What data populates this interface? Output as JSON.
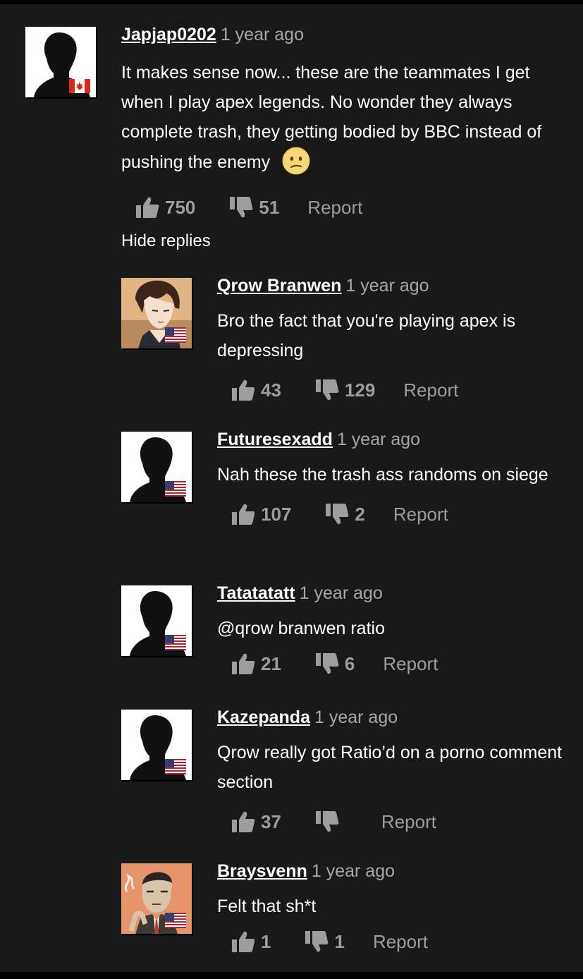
{
  "hide_replies_label": "Hide replies",
  "report_label": "Report",
  "main_comment": {
    "username": "Japjap0202",
    "time": "1 year ago",
    "text": "It makes sense now... these are the teammates I get when I play apex legends. No wonder they always complete trash, they getting bodied by BBC instead of pushing the enemy",
    "emoji": "confused-face",
    "likes": "750",
    "dislikes": "51",
    "flag": "canada"
  },
  "replies": [
    {
      "username": "Qrow Branwen",
      "time": "1 year ago",
      "text": "Bro the fact that you're playing apex is depressing",
      "likes": "43",
      "dislikes": "129",
      "flag": "usa",
      "avatar": "anime-character"
    },
    {
      "username": "Futuresexadd",
      "time": "1 year ago",
      "text": "Nah these the trash ass randoms on siege",
      "likes": "107",
      "dislikes": "2",
      "flag": "usa",
      "avatar": "default-silhouette"
    },
    {
      "username": "Tatatatatt",
      "time": "1 year ago",
      "text": "@qrow branwen ratio",
      "likes": "21",
      "dislikes": "6",
      "flag": "usa",
      "avatar": "default-silhouette"
    },
    {
      "username": "Kazepanda",
      "time": "1 year ago",
      "text": "Qrow really got Ratio’d on a porno comment section",
      "likes": "37",
      "dislikes": "",
      "flag": "usa",
      "avatar": "default-silhouette"
    },
    {
      "username": "Braysvenn",
      "time": "1 year ago",
      "text": "Felt that sh*t",
      "likes": "1",
      "dislikes": "1",
      "flag": "usa",
      "avatar": "smoking-man-illustration"
    }
  ],
  "colors": {
    "background": "#191919",
    "text": "#ffffff",
    "muted": "#9d9d9d",
    "time": "#a7a7a7"
  }
}
